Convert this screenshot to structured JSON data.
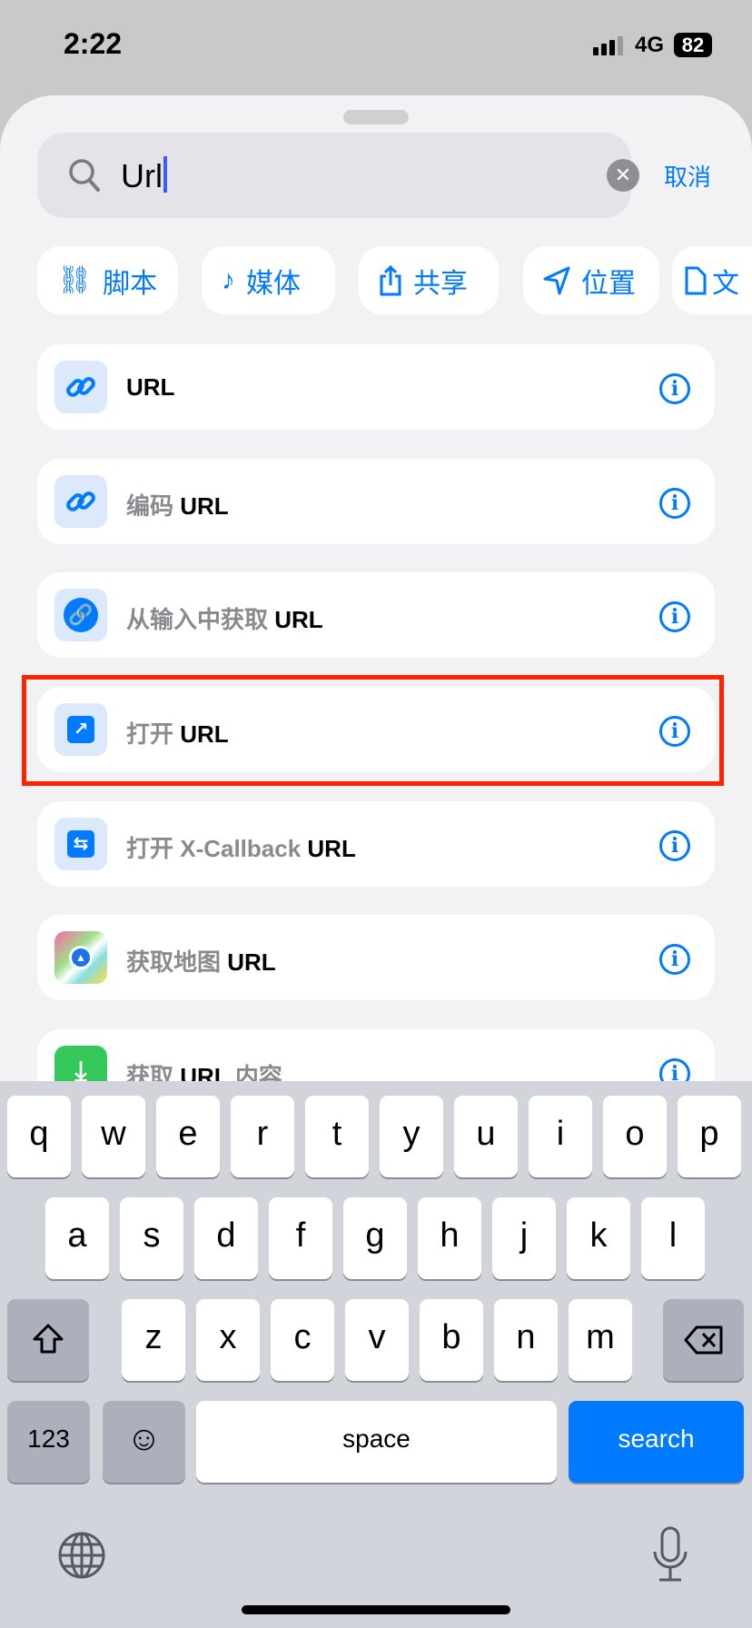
{
  "status": {
    "time": "2:22",
    "network": "4G",
    "battery": "82"
  },
  "search": {
    "value": "Url",
    "cancel": "取消"
  },
  "chips": [
    {
      "icon": "script-icon",
      "label": "脚本"
    },
    {
      "icon": "music-note-icon",
      "label": "媒体"
    },
    {
      "icon": "share-icon",
      "label": "共享"
    },
    {
      "icon": "location-arrow-icon",
      "label": "位置"
    },
    {
      "icon": "document-icon",
      "label": "文"
    }
  ],
  "results": [
    {
      "prefix": "",
      "bold": "URL",
      "icon": "link-icon"
    },
    {
      "prefix": "编码 ",
      "bold": "URL",
      "icon": "link-icon"
    },
    {
      "prefix": "从输入中获取 ",
      "bold": "URL",
      "icon": "link-circle-icon"
    },
    {
      "prefix": "打开 ",
      "bold": "URL",
      "icon": "open-arrow-icon",
      "highlighted": true
    },
    {
      "prefix": "打开 X-Callback ",
      "bold": "URL",
      "icon": "x-callback-icon"
    },
    {
      "prefix": "获取地图 ",
      "bold": "URL",
      "icon": "maps-icon"
    },
    {
      "prefix": "获取 ",
      "bold": "URL",
      "suffix": " 内容",
      "icon": "download-icon"
    }
  ],
  "keyboard": {
    "row1": [
      "q",
      "w",
      "e",
      "r",
      "t",
      "y",
      "u",
      "i",
      "o",
      "p"
    ],
    "row2": [
      "a",
      "s",
      "d",
      "f",
      "g",
      "h",
      "j",
      "k",
      "l"
    ],
    "row3": [
      "z",
      "x",
      "c",
      "v",
      "b",
      "n",
      "m"
    ],
    "numbers": "123",
    "space": "space",
    "search": "search"
  },
  "colors": {
    "accent": "#007aff",
    "highlight": "#ff2200"
  }
}
